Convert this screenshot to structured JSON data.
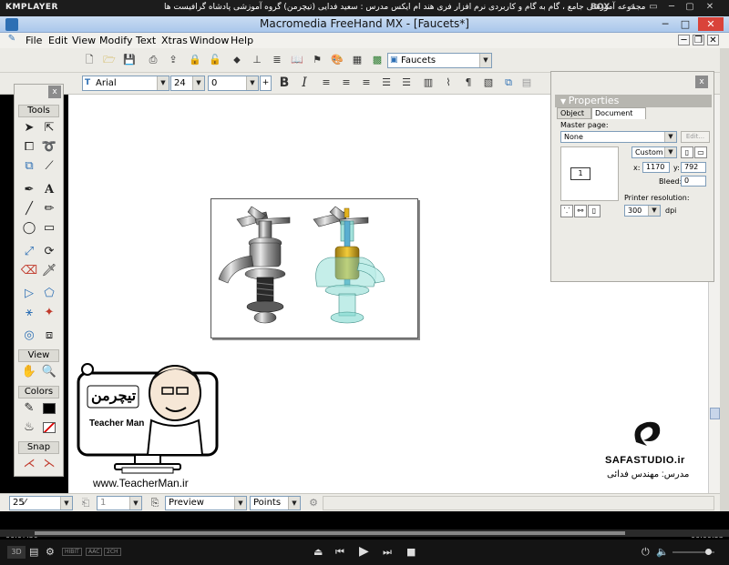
{
  "player": {
    "name": "KMPLAYER",
    "title": "مجموعه آموزشی جامع ، گام به گام و کاربردی نرم افزار فری هند ام ایکس  مدرس : سعید فدایی (تیچرمن) گروه آموزشی پادشاه گرافیست ها",
    "box_label": "BOX",
    "time_elapsed": "00:07:59",
    "time_total": "00:09:53",
    "progress_fraction": 0.81,
    "badges": [
      "3D",
      "HIBIT",
      "AAC",
      "2CH"
    ]
  },
  "window": {
    "caption": "Macromedia FreeHand MX - [Faucets*]",
    "minimize": "─",
    "maximize": "□",
    "close": "✕"
  },
  "menu": {
    "items": [
      "File",
      "Edit",
      "View",
      "Modify",
      "Text",
      "Xtras",
      "Window",
      "Help"
    ]
  },
  "toolbar": {
    "document_select": "Faucets",
    "font_family": "Arial",
    "font_size": "24",
    "leading": "0"
  },
  "tools_panel": {
    "close": "x",
    "tools_header": "Tools",
    "view_header": "View",
    "colors_header": "Colors",
    "snap_header": "Snap"
  },
  "properties": {
    "title": "Properties",
    "close": "x",
    "tabs": [
      "Object",
      "Document"
    ],
    "master_page_label": "Master page:",
    "master_page_value": "None",
    "edit_button": "Edit...",
    "page_number": "1",
    "page_size": "Custom",
    "x_label": "x:",
    "x_value": "1170",
    "y_label": "y:",
    "y_value": "792",
    "bleed_label": "Bleed:",
    "bleed_value": "0",
    "printer_resolution_label": "Printer resolution:",
    "printer_resolution_value": "300",
    "dpi_label": "dpi"
  },
  "status": {
    "zoom": "25⁄",
    "page": "1",
    "view_mode": "Preview",
    "units": "Points"
  },
  "watermarks": {
    "teacherman_url": "www.TeacherMan.ir",
    "teacherman_name": "Teacher Man",
    "teacherman_logo_text": "تیچرمن",
    "safa": "SAFASTUDIO.ir",
    "instructor": "مدرس: مهندس فدائی"
  },
  "colors": {
    "title_gradient_top": "#c9dcf2",
    "close_red": "#d9433a",
    "faucet_highlight_gold": "#e2b21d",
    "faucet_cutaway_teal": "#7fd9cf"
  }
}
